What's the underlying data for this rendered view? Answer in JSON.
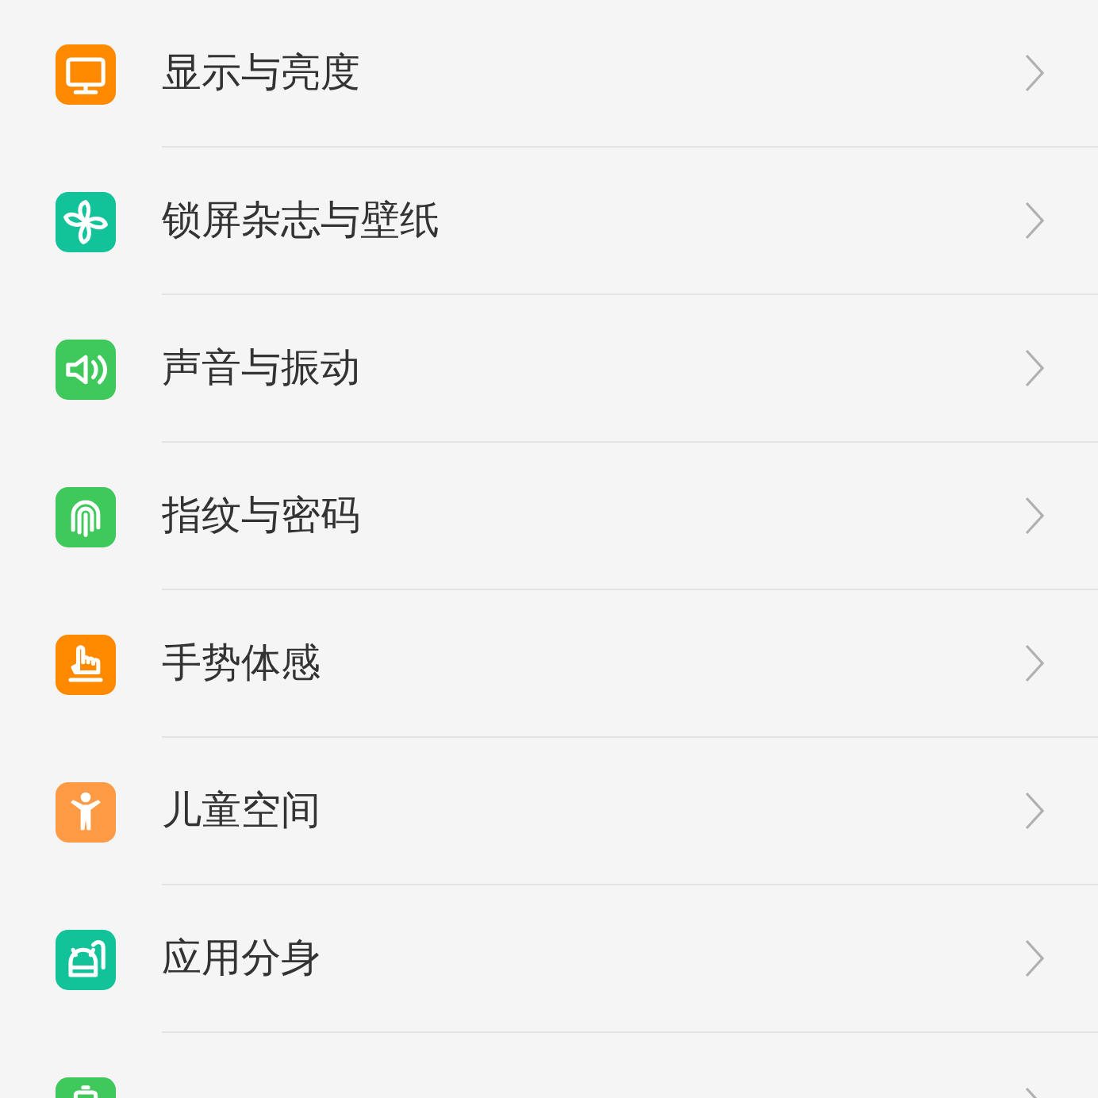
{
  "settings_items": [
    {
      "label": "显示与亮度",
      "kind": "monitor",
      "color": "#ff8a00"
    },
    {
      "label": "锁屏杂志与壁纸",
      "kind": "pinwheel",
      "color": "#12c39a"
    },
    {
      "label": "声音与振动",
      "kind": "speaker",
      "color": "#3ec95a"
    },
    {
      "label": "指纹与密码",
      "kind": "fingerprint",
      "color": "#3ec95a"
    },
    {
      "label": "手势体感",
      "kind": "hand",
      "color": "#ff8a00"
    },
    {
      "label": "儿童空间",
      "kind": "child",
      "color": "#ff9a45"
    },
    {
      "label": "应用分身",
      "kind": "robot",
      "color": "#12c39a"
    },
    {
      "kind": "battery",
      "color": "#3ec95a"
    }
  ]
}
